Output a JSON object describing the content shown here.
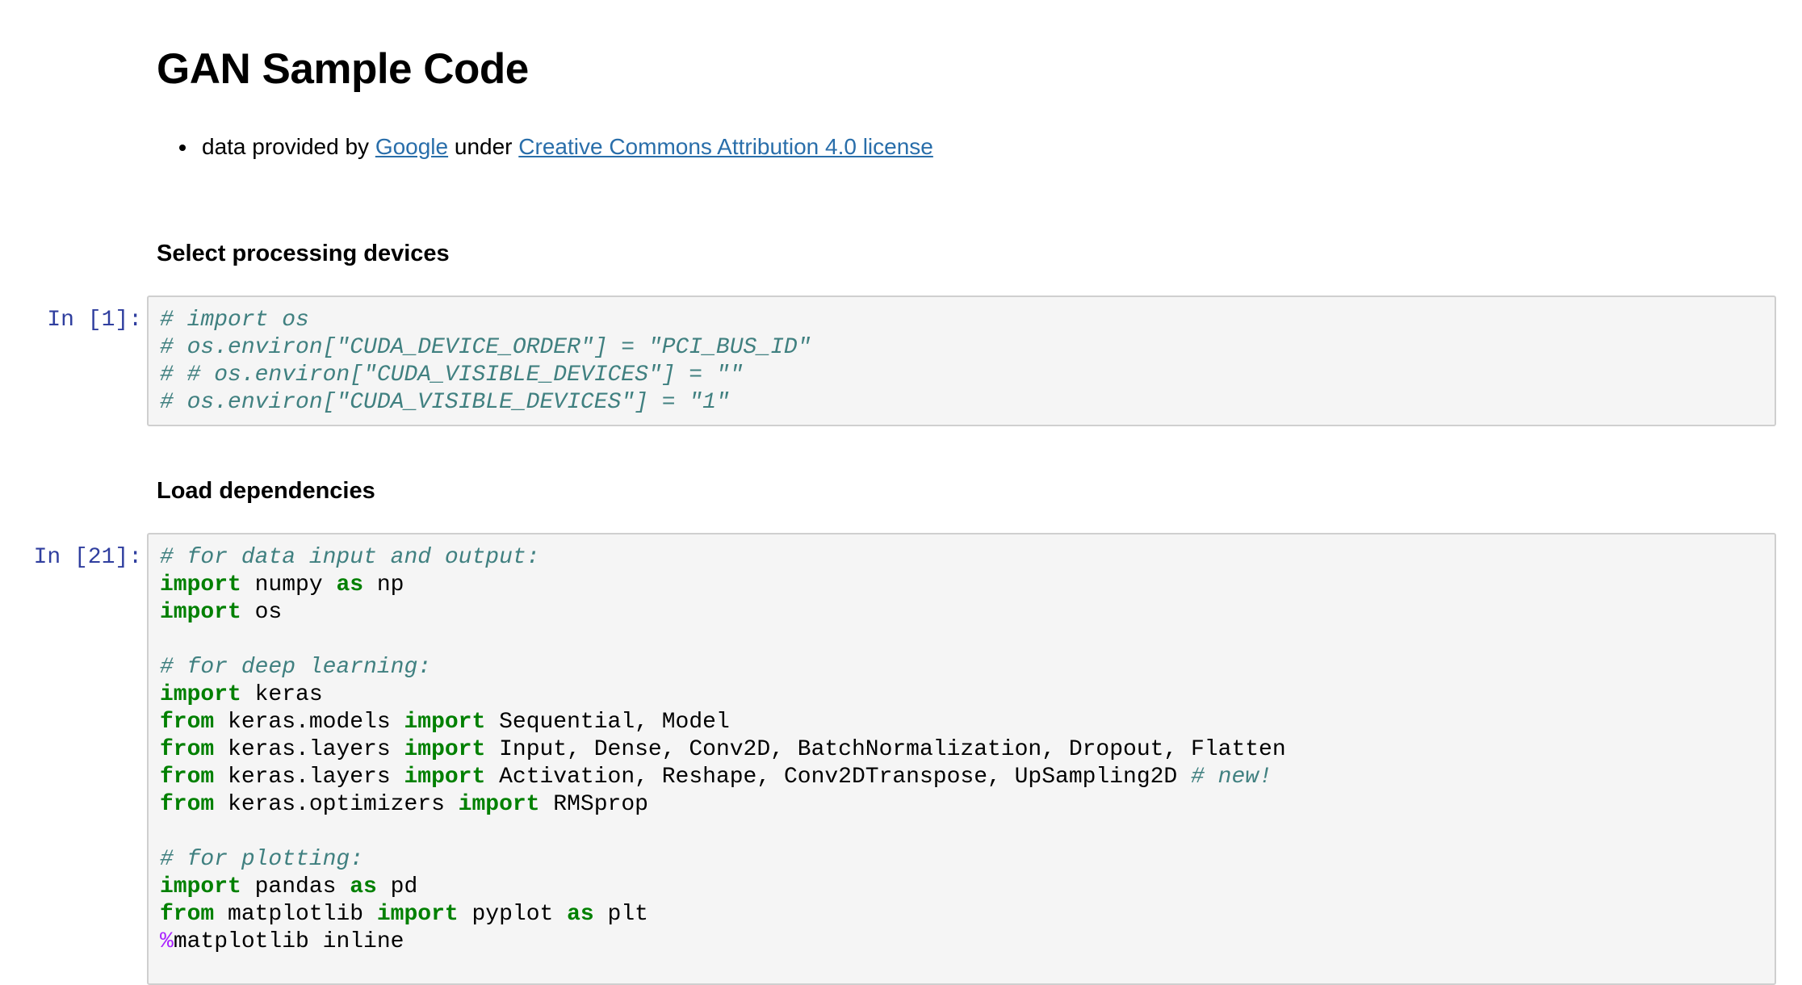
{
  "notebook": {
    "title": "GAN Sample Code",
    "intro": {
      "prefix": "data provided by ",
      "link1": "Google",
      "middle": " under ",
      "link2": "Creative Commons Attribution 4.0 license"
    },
    "sections": [
      {
        "heading": "Select processing devices"
      },
      {
        "heading": "Load dependencies"
      }
    ],
    "cells": [
      {
        "prompt": "In [1]:",
        "lines": [
          [
            {
              "t": "comment",
              "v": "# import os"
            }
          ],
          [
            {
              "t": "comment",
              "v": "# os.environ[\"CUDA_DEVICE_ORDER\"] = \"PCI_BUS_ID\""
            }
          ],
          [
            {
              "t": "comment",
              "v": "# # os.environ[\"CUDA_VISIBLE_DEVICES\"] = \"\""
            }
          ],
          [
            {
              "t": "comment",
              "v": "# os.environ[\"CUDA_VISIBLE_DEVICES\"] = \"1\""
            }
          ]
        ]
      },
      {
        "prompt": "In [21]:",
        "lines": [
          [
            {
              "t": "comment",
              "v": "# for data input and output:"
            }
          ],
          [
            {
              "t": "kw",
              "v": "import"
            },
            {
              "t": "plain",
              "v": " numpy "
            },
            {
              "t": "kw",
              "v": "as"
            },
            {
              "t": "plain",
              "v": " np"
            }
          ],
          [
            {
              "t": "kw",
              "v": "import"
            },
            {
              "t": "plain",
              "v": " os"
            }
          ],
          [],
          [
            {
              "t": "comment",
              "v": "# for deep learning:"
            }
          ],
          [
            {
              "t": "kw",
              "v": "import"
            },
            {
              "t": "plain",
              "v": " keras"
            }
          ],
          [
            {
              "t": "kw",
              "v": "from"
            },
            {
              "t": "plain",
              "v": " keras.models "
            },
            {
              "t": "kw",
              "v": "import"
            },
            {
              "t": "plain",
              "v": " Sequential, Model"
            }
          ],
          [
            {
              "t": "kw",
              "v": "from"
            },
            {
              "t": "plain",
              "v": " keras.layers "
            },
            {
              "t": "kw",
              "v": "import"
            },
            {
              "t": "plain",
              "v": " Input, Dense, Conv2D, BatchNormalization, Dropout, Flatten"
            }
          ],
          [
            {
              "t": "kw",
              "v": "from"
            },
            {
              "t": "plain",
              "v": " keras.layers "
            },
            {
              "t": "kw",
              "v": "import"
            },
            {
              "t": "plain",
              "v": " Activation, Reshape, Conv2DTranspose, UpSampling2D "
            },
            {
              "t": "comment",
              "v": "# new!"
            }
          ],
          [
            {
              "t": "kw",
              "v": "from"
            },
            {
              "t": "plain",
              "v": " keras.optimizers "
            },
            {
              "t": "kw",
              "v": "import"
            },
            {
              "t": "plain",
              "v": " RMSprop"
            }
          ],
          [],
          [
            {
              "t": "comment",
              "v": "# for plotting:"
            }
          ],
          [
            {
              "t": "kw",
              "v": "import"
            },
            {
              "t": "plain",
              "v": " pandas "
            },
            {
              "t": "kw",
              "v": "as"
            },
            {
              "t": "plain",
              "v": " pd"
            }
          ],
          [
            {
              "t": "kw",
              "v": "from"
            },
            {
              "t": "plain",
              "v": " matplotlib "
            },
            {
              "t": "kw",
              "v": "import"
            },
            {
              "t": "plain",
              "v": " pyplot "
            },
            {
              "t": "kw",
              "v": "as"
            },
            {
              "t": "plain",
              "v": " plt"
            }
          ],
          [
            {
              "t": "magic",
              "v": "%"
            },
            {
              "t": "plain",
              "v": "matplotlib inline"
            }
          ]
        ]
      }
    ]
  }
}
